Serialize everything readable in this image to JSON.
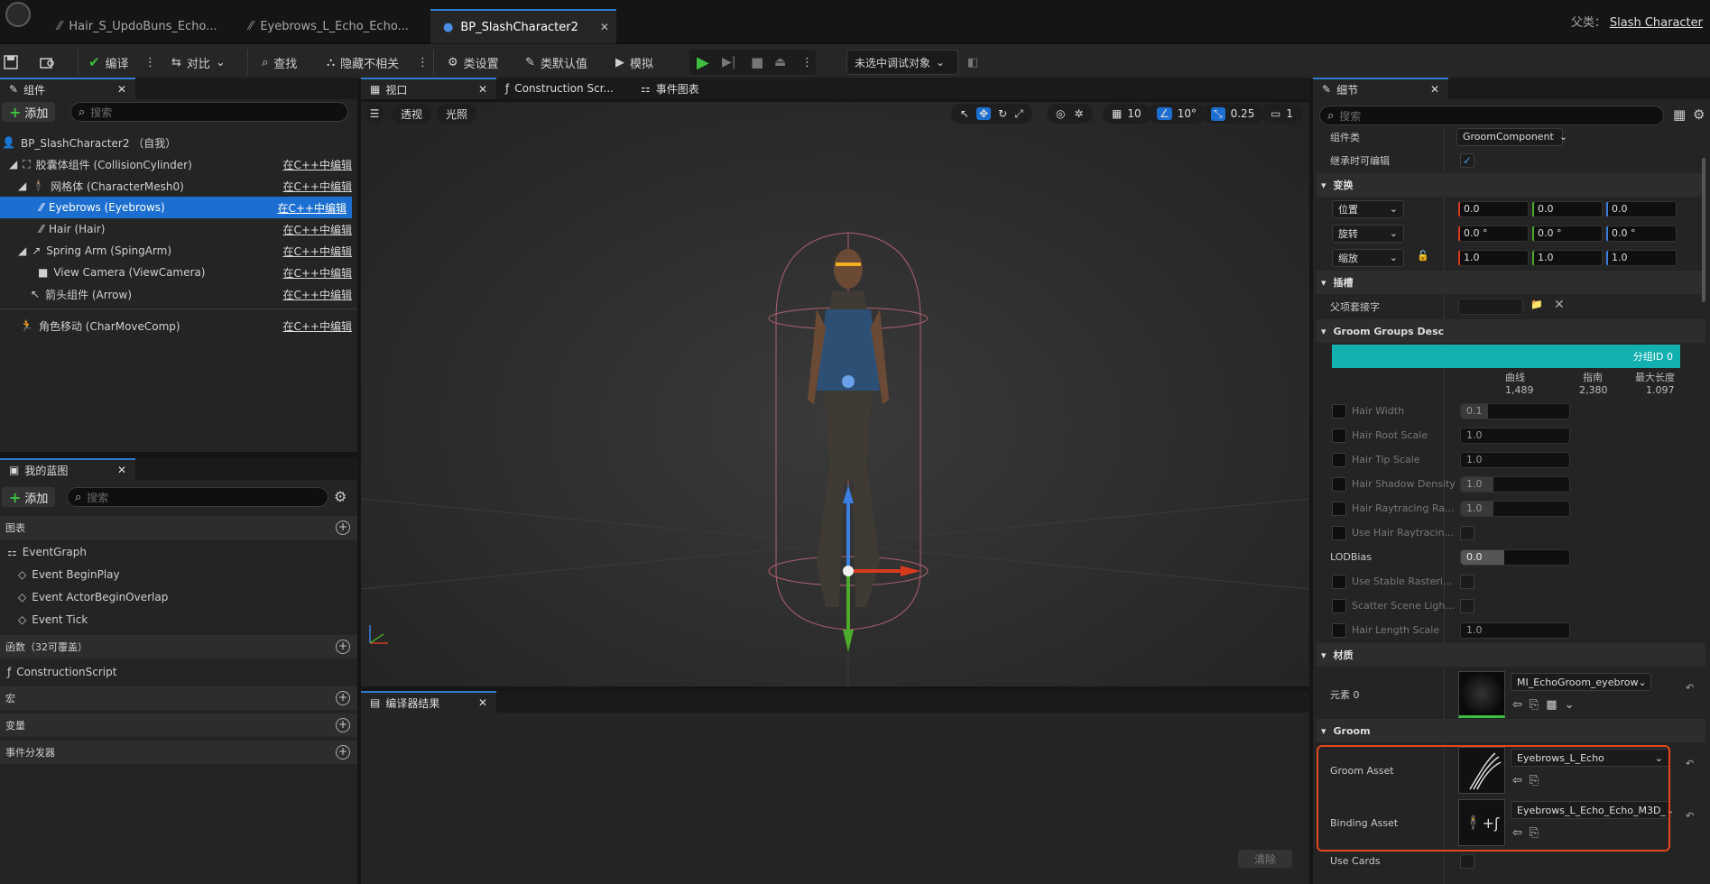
{
  "titlebar": {
    "tabs": [
      {
        "label": "Hair_S_UpdoBuns_Echo..."
      },
      {
        "label": "Eyebrows_L_Echo_Echo..."
      },
      {
        "label": "BP_SlashCharacter2",
        "active": true
      }
    ],
    "parent_label": "父类：",
    "parent_value": "Slash Character"
  },
  "toolbar": {
    "compile": "编译",
    "diff": "对比",
    "find": "查找",
    "hide_unrelated": "隐藏不相关",
    "class_settings": "类设置",
    "class_defaults": "类默认值",
    "simulate": "模拟",
    "debug_object": "未选中调试对象"
  },
  "components": {
    "tab": "组件",
    "add": "添加",
    "search_placeholder": "搜索",
    "root": "BP_SlashCharacter2 （自我）",
    "items": [
      {
        "label": "胶囊体组件 (CollisionCylinder)",
        "edit": "在C++中编辑"
      },
      {
        "label": "网格体 (CharacterMesh0)",
        "edit": "在C++中编辑"
      },
      {
        "label": "Eyebrows (Eyebrows)",
        "edit": "在C++中编辑",
        "selected": true
      },
      {
        "label": "Hair (Hair)",
        "edit": "在C++中编辑"
      },
      {
        "label": "Spring Arm (SpingArm)",
        "edit": "在C++中编辑"
      },
      {
        "label": "View Camera (ViewCamera)",
        "edit": "在C++中编辑"
      },
      {
        "label": "箭头组件 (Arrow)",
        "edit": "在C++中编辑"
      },
      {
        "label": "角色移动 (CharMoveComp)",
        "edit": "在C++中编辑"
      }
    ]
  },
  "myblueprint": {
    "tab": "我的蓝图",
    "add": "添加",
    "search_placeholder": "搜索",
    "graphs_header": "图表",
    "event_graph": "EventGraph",
    "events": [
      "Event BeginPlay",
      "Event ActorBeginOverlap",
      "Event Tick"
    ],
    "functions_header": "函数（32可覆盖）",
    "construction_script": "ConstructionScript",
    "macros_header": "宏",
    "variables_header": "变量",
    "dispatchers_header": "事件分发器"
  },
  "center_tabs": {
    "viewport": "视口",
    "construction": "Construction Scr...",
    "event_graph": "事件图表"
  },
  "viewport": {
    "perspective": "透视",
    "lit": "光照",
    "grid_snap": "10",
    "rot_snap": "10°",
    "scale_snap": "0.25",
    "cam_speed": "1"
  },
  "compiler": {
    "tab": "编译器结果",
    "clear": "清除"
  },
  "details": {
    "tab": "细节",
    "search_placeholder": "搜索",
    "component_class_label": "组件类",
    "component_class_value": "GroomComponent",
    "editable_label": "继承时可编辑",
    "transform_header": "变换",
    "location": "位置",
    "rotation": "旋转",
    "scale": "缩放",
    "loc_values": [
      "0.0",
      "0.0",
      "0.0"
    ],
    "rot_values": [
      "0.0 °",
      "0.0 °",
      "0.0 °"
    ],
    "scale_values": [
      "1.0",
      "1.0",
      "1.0"
    ],
    "sockets_header": "插槽",
    "parent_socket": "父项套接字",
    "groom_groups_header": "Groom Groups Desc",
    "group_id": "分组ID 0",
    "stat_headers": [
      "曲线",
      "指南",
      "最大长度"
    ],
    "stat_values": [
      "1,489",
      "2,380",
      "1.097"
    ],
    "props": [
      {
        "label": "Hair Width",
        "value": "0.1",
        "fill": 0.25
      },
      {
        "label": "Hair Root Scale",
        "value": "1.0",
        "fill": 0
      },
      {
        "label": "Hair Tip Scale",
        "value": "1.0",
        "fill": 0
      },
      {
        "label": "Hair Shadow Density",
        "value": "1.0",
        "fill": 0.3
      },
      {
        "label": "Hair Raytracing Ra...",
        "value": "1.0",
        "fill": 0.3
      },
      {
        "label": "Use Hair Raytracin...",
        "value": "",
        "checkbox": true
      }
    ],
    "lodbias_label": "LODBias",
    "lodbias_value": "0.0",
    "more_props": [
      {
        "label": "Use Stable Rasteri..."
      },
      {
        "label": "Scatter Scene Ligh..."
      },
      {
        "label": "Hair Length Scale",
        "value": "1.0"
      }
    ],
    "materials_header": "材质",
    "element0": "元素 0",
    "material_value": "MI_EchoGroom_eyebrow",
    "groom_header": "Groom",
    "groom_asset_label": "Groom Asset",
    "groom_asset_value": "Eyebrows_L_Echo",
    "binding_asset_label": "Binding Asset",
    "binding_asset_value": "Eyebrows_L_Echo_Echo_M3D_",
    "use_cards": "Use Cards"
  },
  "colors": {
    "accent": "#1c6fd1",
    "teal": "#13b0b0",
    "play": "#3fbf3f",
    "highlight": "#e2471d"
  }
}
